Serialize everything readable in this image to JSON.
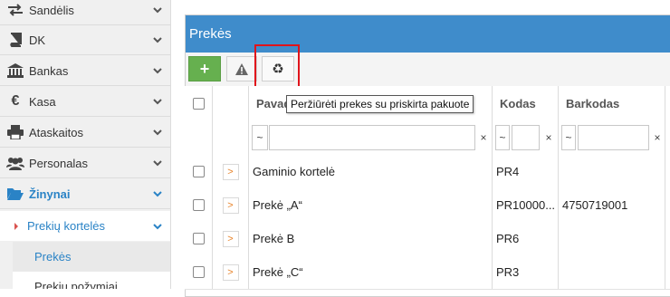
{
  "sidebar": {
    "items": [
      {
        "label": "Sandėlis",
        "icon": "exchange-arrows-icon"
      },
      {
        "label": "DK",
        "icon": "book-icon"
      },
      {
        "label": "Bankas",
        "icon": "bank-icon"
      },
      {
        "label": "Kasa",
        "icon": "euro-icon"
      },
      {
        "label": "Ataskaitos",
        "icon": "printer-icon"
      },
      {
        "label": "Personalas",
        "icon": "users-icon"
      },
      {
        "label": "Žinynai",
        "icon": "folder-open-icon"
      }
    ],
    "sub_item": {
      "label": "Prekių kortelės"
    },
    "sub_sub_items": [
      {
        "label": "Prekės"
      },
      {
        "label": "Prekių požymiai"
      }
    ]
  },
  "panel": {
    "title": "Prekės",
    "tooltip": "Peržiūrėti prekes su priskirta pakuote",
    "add_symbol": "+",
    "warn_symbol": "!",
    "recycle_symbol": "♻"
  },
  "table": {
    "columns": {
      "name": "Pavadinimas",
      "code": "Kodas",
      "barcode": "Barkodas"
    },
    "filter": {
      "op": "~",
      "clear": "×"
    },
    "rows": [
      {
        "name": "Gaminio kortelė",
        "code": "PR4",
        "barcode": ""
      },
      {
        "name": "Prekė „A“",
        "code": "PR10000...",
        "barcode": "4750719001"
      },
      {
        "name": "Prekė B",
        "code": "PR6",
        "barcode": ""
      },
      {
        "name": "Prekė „C“",
        "code": "PR3",
        "barcode": ""
      }
    ]
  },
  "colors": {
    "accent": "#3f8ccb",
    "link": "#2a83c6",
    "add": "#66b04f",
    "highlight": "#e0141b"
  }
}
